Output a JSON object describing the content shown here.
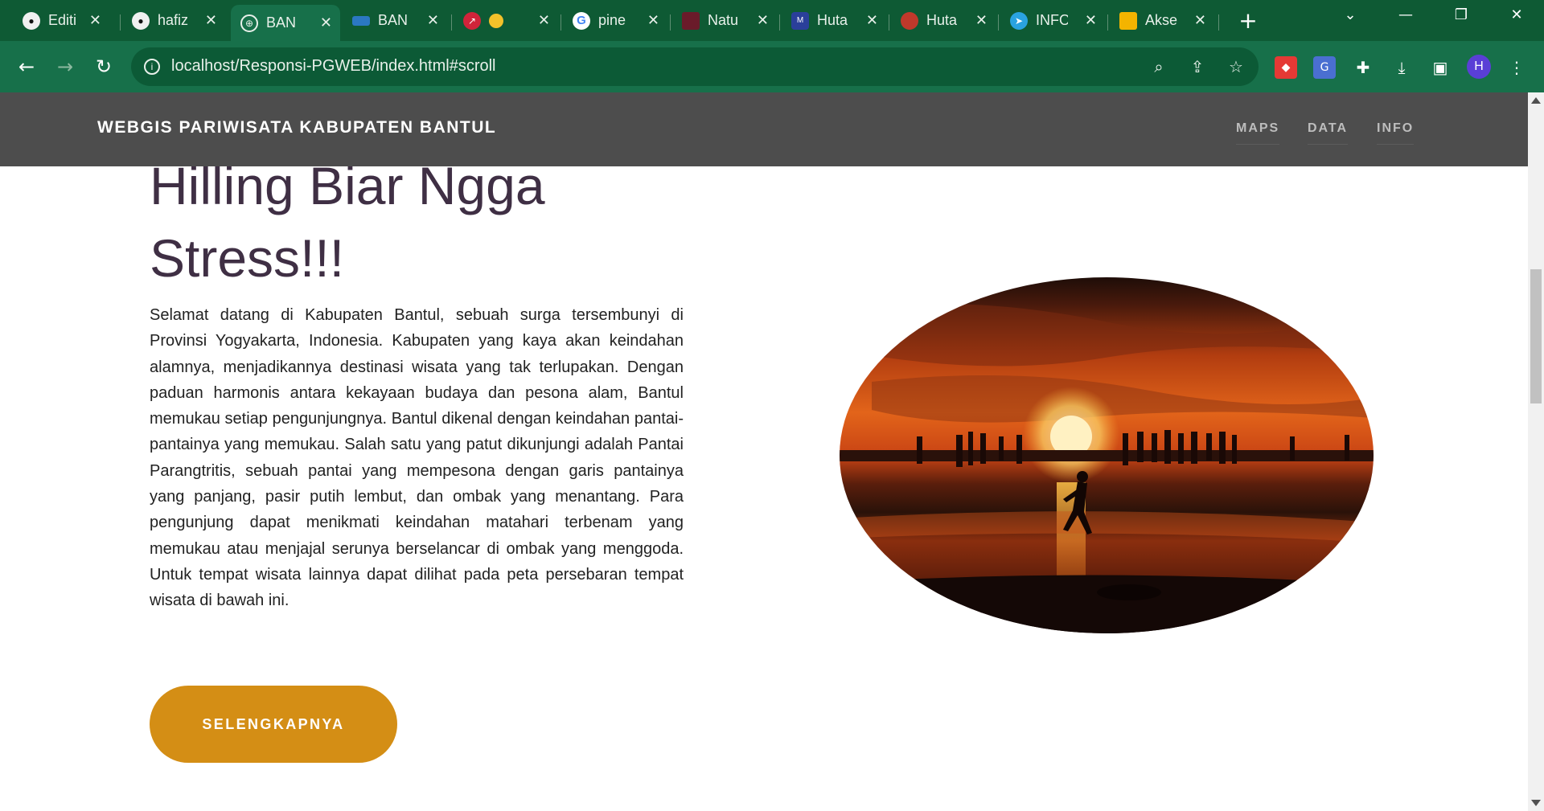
{
  "browser": {
    "tabs": [
      {
        "title": "Editi",
        "favicon": "github-icon"
      },
      {
        "title": "hafiz",
        "favicon": "github-icon"
      },
      {
        "title": "BAN",
        "favicon": "globe-icon",
        "active": true
      },
      {
        "title": "BAN",
        "favicon": "site-icon"
      },
      {
        "title": "",
        "favicon": "thumbs-up-icon"
      },
      {
        "title": "pine",
        "favicon": "google-icon"
      },
      {
        "title": "Natu",
        "favicon": "site-icon"
      },
      {
        "title": "Huta",
        "favicon": "site-icon"
      },
      {
        "title": "Huta",
        "favicon": "site-icon"
      },
      {
        "title": "INFO",
        "favicon": "telegram-icon"
      },
      {
        "title": "Akse",
        "favicon": "slides-icon"
      }
    ],
    "url": "localhost/Responsi-PGWEB/index.html#scroll",
    "profile_initial": "H"
  },
  "site": {
    "brand": "WEBGIS PARIWISATA KABUPATEN BANTUL",
    "nav": [
      "MAPS",
      "DATA",
      "INFO"
    ],
    "heading_line1": "Hilling Biar Ngga",
    "heading_line2": "Stress!!!",
    "intro": "Selamat datang di Kabupaten Bantul, sebuah surga tersembunyi di Provinsi Yogyakarta, Indonesia. Kabupaten yang kaya akan keindahan alamnya, menjadikannya destinasi wisata yang tak terlupakan. Dengan paduan harmonis antara kekayaan budaya dan pesona alam, Bantul memukau setiap pengunjungnya. Bantul dikenal dengan keindahan pantai-pantainya yang memukau. Salah satu yang patut dikunjungi adalah Pantai Parangtritis, sebuah pantai yang mempesona dengan garis pantainya yang panjang, pasir putih lembut, dan ombak yang menantang. Para pengunjung dapat menikmati keindahan matahari terbenam yang memukau atau menjajal serunya berselancar di ombak yang menggoda. Untuk tempat wisata lainnya dapat dilihat pada peta persebaran tempat wisata di bawah ini.",
    "cta_label": "SELENGKAPNYA"
  },
  "colors": {
    "chrome_dark": "#0e5a34",
    "chrome": "#17704a",
    "navbar": "#4d4d4d",
    "heading": "#3f2f44",
    "cta": "#d48e15"
  }
}
